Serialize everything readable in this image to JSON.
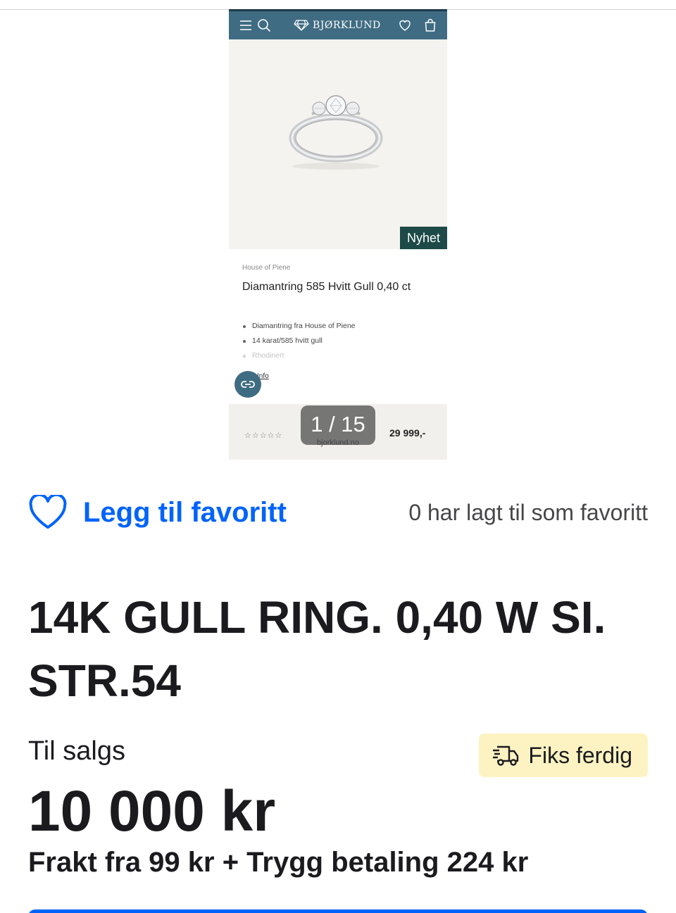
{
  "screenshot": {
    "brand": "BJØRKLUND",
    "badge_new": "Nyhet",
    "product_brand": "House of Piene",
    "product_name": "Diamantring 585 Hvitt Gull 0,40 ct",
    "bullets": [
      "Diamantring fra House of Piene",
      "14 karat/585 hvitt gull",
      "Rhodinert"
    ],
    "info_link": "Info",
    "rating_stars": "☆☆☆☆☆",
    "price": "29 999,-",
    "image_counter": "1 / 15",
    "source": "bjorklund.no",
    "colors": {
      "nav": "#3f6c82",
      "badge": "#1d4a48"
    }
  },
  "favorite": {
    "label": "Legg til favoritt",
    "count_text": "0 har lagt til som favoritt",
    "icon": "heart-icon"
  },
  "listing": {
    "title": "14K GULL RING. 0,40 W SI. STR.54",
    "status": "Til salgs",
    "badge": "Fiks ferdig",
    "badge_icon": "delivery-truck-icon",
    "price": "10 000 kr",
    "shipping": "Frakt fra 99 kr + Trygg betaling 224 kr",
    "colors": {
      "accent": "#0063fb",
      "badge_bg": "#fdf3c2"
    }
  }
}
